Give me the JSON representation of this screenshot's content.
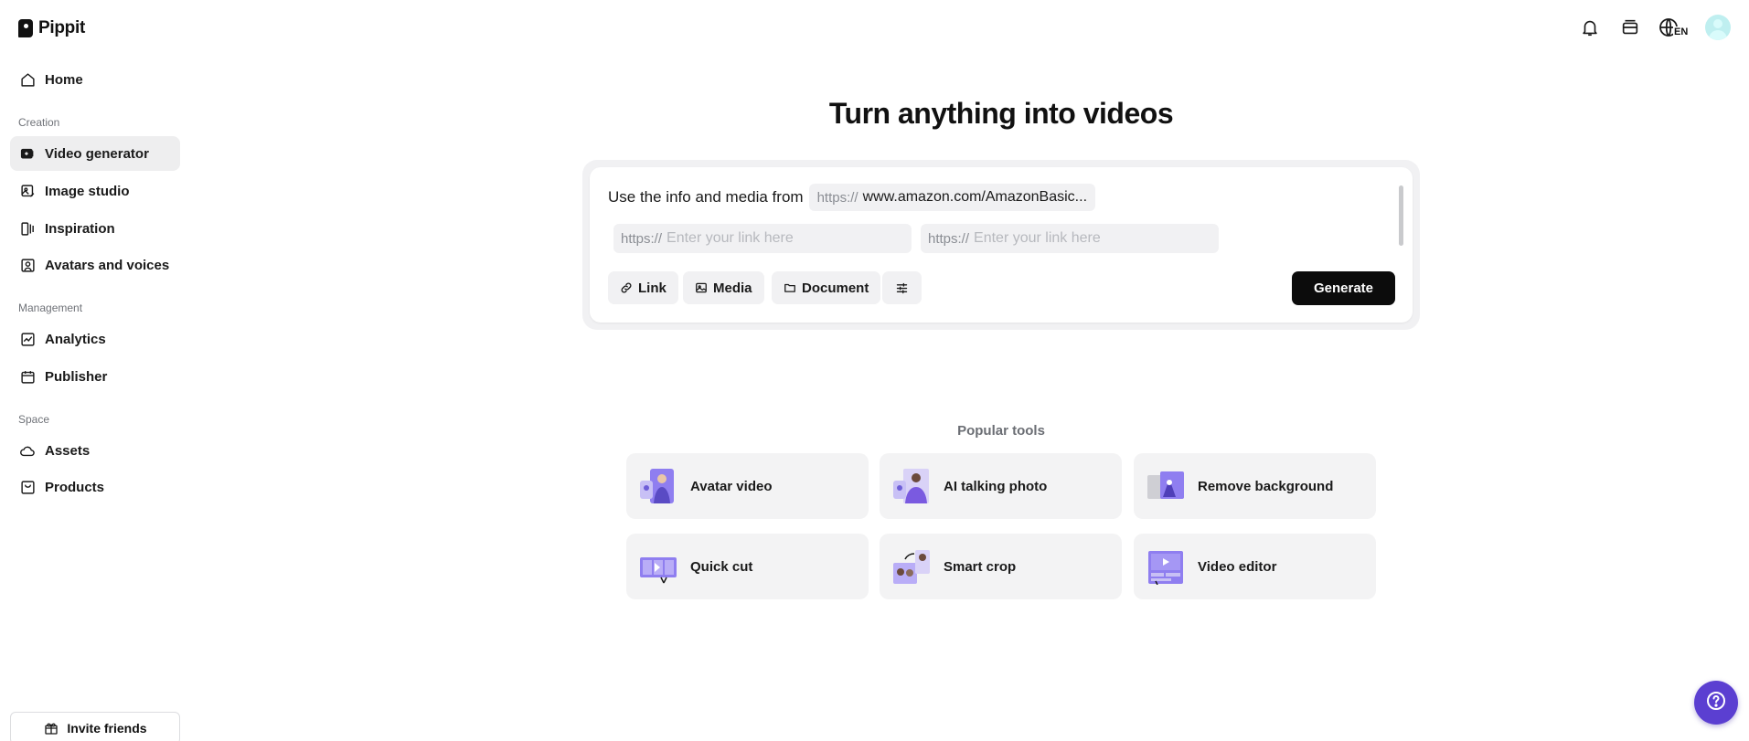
{
  "app": {
    "name": "Pippit"
  },
  "sidebar": {
    "home": {
      "label": "Home"
    },
    "sections": {
      "creation": "Creation",
      "management": "Management",
      "space": "Space"
    },
    "creation_items": [
      {
        "label": "Video generator",
        "icon": "video-plus-icon",
        "active": true
      },
      {
        "label": "Image studio",
        "icon": "image-edit-icon"
      },
      {
        "label": "Inspiration",
        "icon": "inspiration-icon"
      },
      {
        "label": "Avatars and voices",
        "icon": "avatar-voice-icon"
      }
    ],
    "management_items": [
      {
        "label": "Analytics",
        "icon": "analytics-icon"
      },
      {
        "label": "Publisher",
        "icon": "calendar-icon"
      }
    ],
    "space_items": [
      {
        "label": "Assets",
        "icon": "cloud-icon"
      },
      {
        "label": "Products",
        "icon": "product-box-icon"
      }
    ],
    "invite": {
      "label": "Invite friends",
      "icon": "gift-icon"
    }
  },
  "topbar": {
    "icons": [
      "bell-icon",
      "credits-icon",
      "language-globe-icon",
      "user-avatar"
    ],
    "language_code": "EN"
  },
  "main": {
    "title": "Turn anything into videos",
    "composer": {
      "prompt": "Use the info and media from",
      "url_prefix": "https://",
      "url_value": "www.amazon.com/AmazonBasic...",
      "link_fields": [
        {
          "prefix": "https://",
          "placeholder": "Enter your link here"
        },
        {
          "prefix": "https://",
          "placeholder": "Enter your link here"
        }
      ],
      "buttons": {
        "link": "Link",
        "media": "Media",
        "document": "Document",
        "settings": "settings-sliders-icon"
      },
      "generate": "Generate"
    },
    "popular": {
      "label": "Popular tools",
      "tools": [
        {
          "label": "Avatar video"
        },
        {
          "label": "AI talking photo"
        },
        {
          "label": "Remove background"
        },
        {
          "label": "Quick cut"
        },
        {
          "label": "Smart crop"
        },
        {
          "label": "Video editor"
        }
      ]
    }
  },
  "help": {
    "icon": "help-question-icon"
  },
  "colors": {
    "accent_purple": "#5b3fd1",
    "generate_bg": "#0c0c0c",
    "active_nav_bg": "#eeeeef",
    "card_bg": "#f3f3f4"
  }
}
